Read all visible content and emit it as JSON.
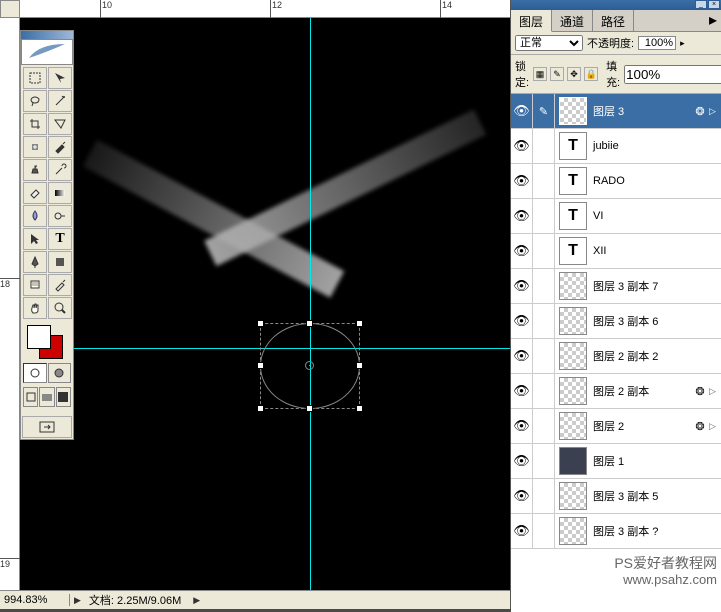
{
  "ruler": {
    "h_marks": [
      "10",
      "12",
      "14"
    ],
    "v_marks": [
      "18",
      "19"
    ]
  },
  "statusbar": {
    "zoom": "994.83%",
    "doc_label": "文档:",
    "doc_value": "2.25M/9.06M"
  },
  "panel": {
    "tabs": {
      "layers": "图层",
      "channels": "通道",
      "paths": "路径"
    },
    "blend_mode": "正常",
    "opacity_label": "不透明度:",
    "opacity_value": "100%",
    "lock_label": "锁定:",
    "fill_label": "填充:",
    "fill_value": "100%"
  },
  "layers": [
    {
      "name": "图层 3",
      "type": "raster",
      "selected": true,
      "fx": true
    },
    {
      "name": "jubiie",
      "type": "text"
    },
    {
      "name": "RADO",
      "type": "text"
    },
    {
      "name": "VI",
      "type": "text"
    },
    {
      "name": "XII",
      "type": "text"
    },
    {
      "name": "图层 3 副本 7",
      "type": "raster"
    },
    {
      "name": "图层 3 副本 6",
      "type": "raster"
    },
    {
      "name": "图层 2 副本 2",
      "type": "raster"
    },
    {
      "name": "图层 2 副本",
      "type": "raster",
      "fx": true
    },
    {
      "name": "图层 2",
      "type": "raster",
      "fx": true
    },
    {
      "name": "图层 1",
      "type": "filled"
    },
    {
      "name": "图层 3 副本 5",
      "type": "raster"
    },
    {
      "name": "图层 3 副本 ?",
      "type": "raster"
    }
  ],
  "watermark": {
    "cn": "PS爱好者教程网",
    "url": "www.psahz.com"
  },
  "icons": {
    "eye": "👁",
    "brush": "✎"
  }
}
